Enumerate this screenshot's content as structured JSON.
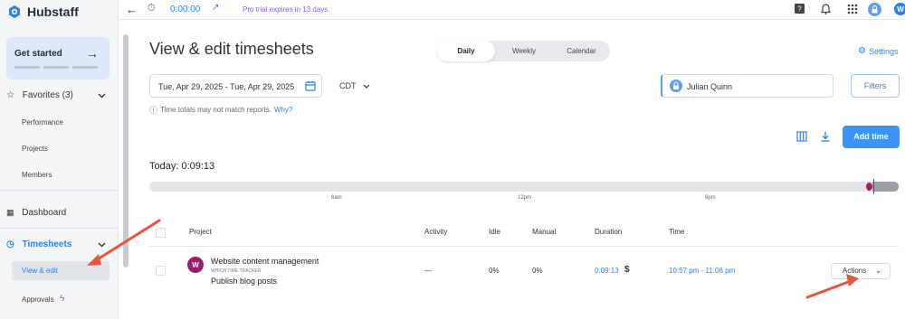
{
  "app": {
    "name": "Hubstaff"
  },
  "topbar": {
    "timer_value": "0:00:00",
    "trial_text": "Pro trial expires in 13 days.",
    "user_initial": "W"
  },
  "sidebar": {
    "get_started": "Get started",
    "favorites": "Favorites (3)",
    "favorites_items": [
      "Performance",
      "Projects",
      "Members"
    ],
    "dashboard": "Dashboard",
    "timesheets": "Timesheets",
    "view_edit": "View & edit",
    "approvals": "Approvals"
  },
  "header": {
    "title": "View & edit timesheets",
    "tabs": [
      "Daily",
      "Weekly",
      "Calendar"
    ],
    "active_tab": "Daily",
    "settings": "Settings"
  },
  "filters": {
    "date_range": "Tue, Apr 29, 2025 - Tue, Apr 29, 2025",
    "timezone": "CDT",
    "note": "Time totals may not match reports.",
    "why": "Why?",
    "user": "Julian Quinn",
    "filters_button": "Filters",
    "add_time": "Add time"
  },
  "summary": {
    "today": "Today: 0:09:13",
    "ticks": [
      "6am",
      "12pm",
      "6pm"
    ]
  },
  "table": {
    "columns": [
      "Project",
      "Activity",
      "Idle",
      "Manual",
      "Duration",
      "Time"
    ],
    "rows": [
      {
        "avatar": "W",
        "project": "Website content management",
        "tracker": "WHICH TIME TRACKER",
        "task": "Publish blog posts",
        "activity": "—",
        "idle": "0%",
        "manual": "0%",
        "duration": "0:09:13",
        "paid_symbol": "$",
        "time": "10:57 pm - 11:06 pm",
        "actions": "Actions"
      }
    ]
  },
  "colors": {
    "accent": "#2f80ed",
    "primary_button": "#3b94f7",
    "project_avatar": "#9b1c6b",
    "annotation_arrow": "#e8553f"
  }
}
